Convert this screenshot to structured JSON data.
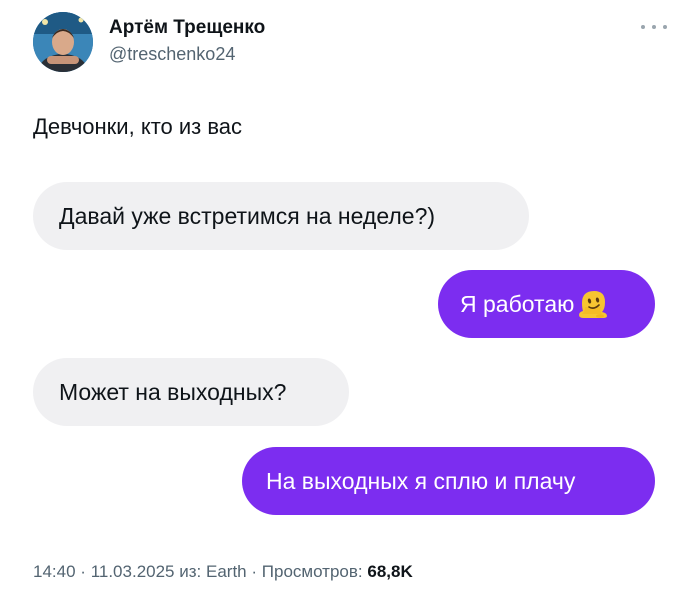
{
  "author": {
    "display_name": "Артём Трещенко",
    "handle": "@treschenko24"
  },
  "tweet": {
    "text": "Девчонки, кто из вас"
  },
  "messages": [
    {
      "side": "incoming",
      "text": "Давай уже встретимся на неделе?)"
    },
    {
      "side": "outgoing",
      "text": "Я работаю",
      "emoji": "melting-face-emoji"
    },
    {
      "side": "incoming",
      "text": "Может на выходных?"
    },
    {
      "side": "outgoing",
      "text": "На выходных я сплю и плачу"
    }
  ],
  "meta": {
    "time": "14:40",
    "date": "11.03.2025",
    "source_prefix": "из:",
    "source": "Earth",
    "views_label": "Просмотров:",
    "views_count": "68,8K",
    "separator": "·"
  },
  "icons": {
    "more": "more-horizontal-icon"
  },
  "colors": {
    "outgoing_bubble": "#7c2df0",
    "incoming_bubble": "#f0f0f2",
    "secondary_text": "#536471",
    "primary_text": "#0f1419"
  }
}
